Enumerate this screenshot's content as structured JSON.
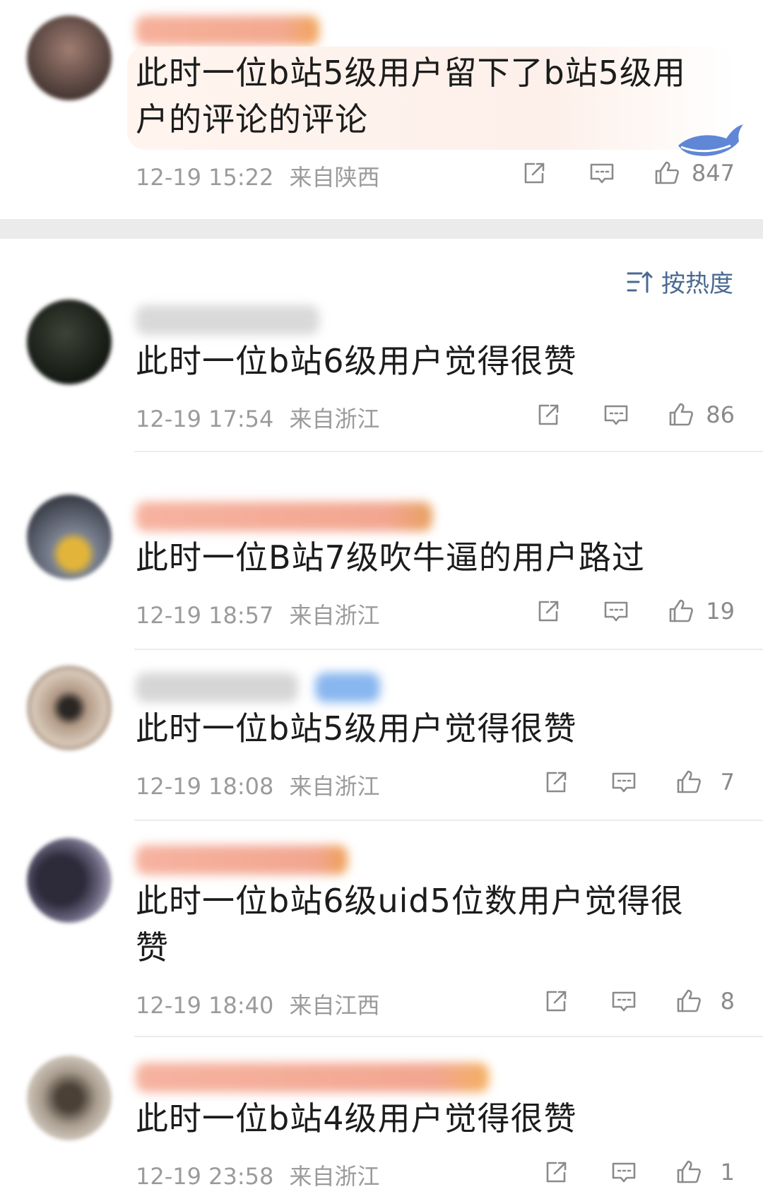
{
  "colors": {
    "accent": "#4a6a93",
    "meta": "#9b9b9b",
    "icon": "#8a8a8a"
  },
  "sort_label": "按热度",
  "top_comment": {
    "text": "此时一位b站5级用户留下了b站5级用户的评论的评论",
    "date": "12-19 15:22",
    "location": "来自陕西",
    "likes": "847"
  },
  "comments": [
    {
      "text": "此时一位b站6级用户觉得很赞",
      "date": "12-19 17:54",
      "location": "来自浙江",
      "likes": "86"
    },
    {
      "text": "此时一位B站7级吹牛逼的用户路过",
      "date": "12-19 18:57",
      "location": "来自浙江",
      "likes": "19"
    },
    {
      "text": "此时一位b站5级用户觉得很赞",
      "date": "12-19 18:08",
      "location": "来自浙江",
      "likes": "7"
    },
    {
      "text": "此时一位b站6级uid5位数用户觉得很赞",
      "date": "12-19 18:40",
      "location": "来自江西",
      "likes": "8"
    },
    {
      "text": "此时一位b站4级用户觉得很赞",
      "date": "12-19 23:58",
      "location": "来自浙江",
      "likes": "1"
    }
  ],
  "icons": {
    "share": "share-icon",
    "reply": "comment-icon",
    "like": "thumbs-up-icon",
    "sort": "sort-icon"
  }
}
